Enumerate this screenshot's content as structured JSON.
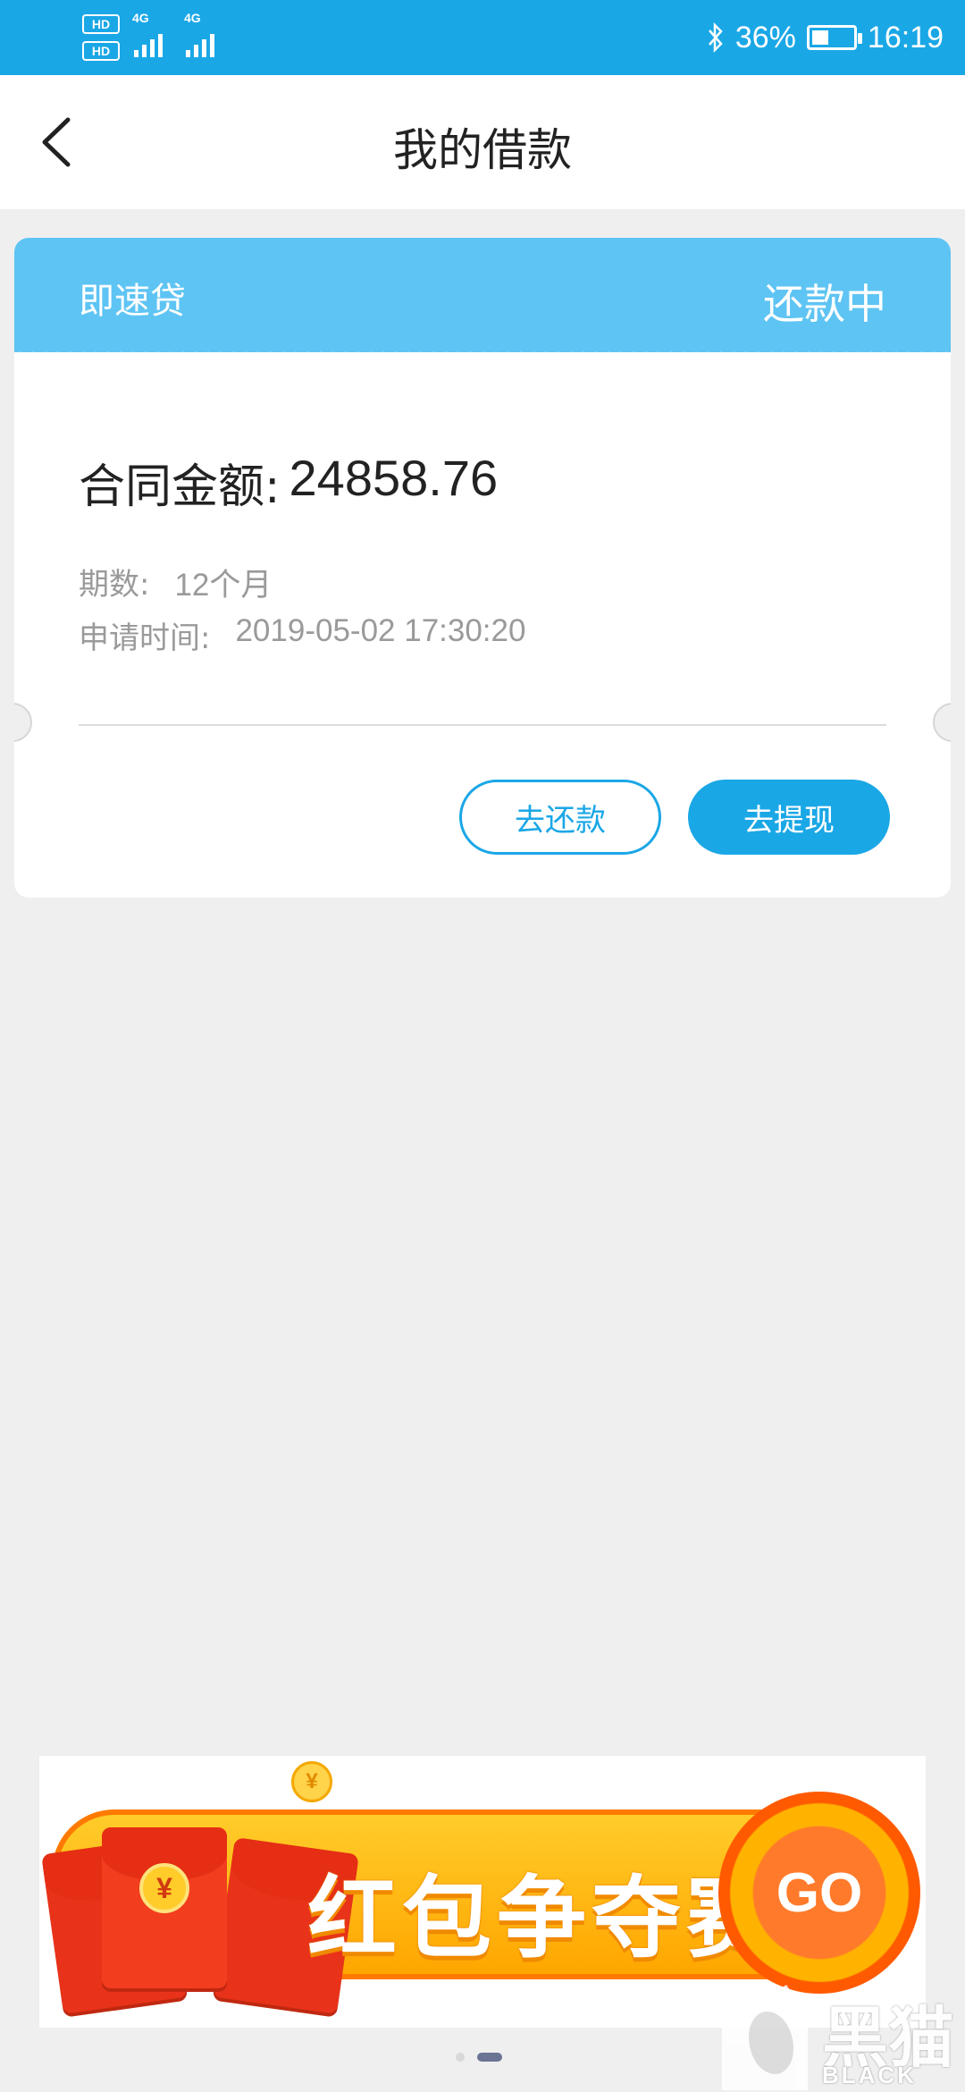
{
  "status_bar": {
    "hd1": "HD",
    "hd2": "HD",
    "net1": "4G",
    "net2": "4G",
    "battery": "36%",
    "time": "16:19"
  },
  "header": {
    "title": "我的借款"
  },
  "loan_card": {
    "product_name": "即速贷",
    "status": "还款中",
    "amount_label": "合同金额:",
    "amount_value": "24858.76",
    "term_label": "期数:",
    "term_value": "12个月",
    "apply_time_label": "申请时间:",
    "apply_time_value": "2019-05-02 17:30:20",
    "repay_button": "去还款",
    "withdraw_button": "去提现"
  },
  "banner": {
    "text": "红包争夺赛",
    "go": "GO",
    "coin_symbol": "¥"
  },
  "pager": {
    "count": 2,
    "active_index": 1
  },
  "watermark": {
    "cn": "黑猫",
    "en": "BLACK CAT"
  },
  "colors": {
    "status_bar": "#1aa7e6",
    "card_header": "#5ec4f3",
    "primary": "#1aa7e6",
    "background": "#efefef"
  }
}
